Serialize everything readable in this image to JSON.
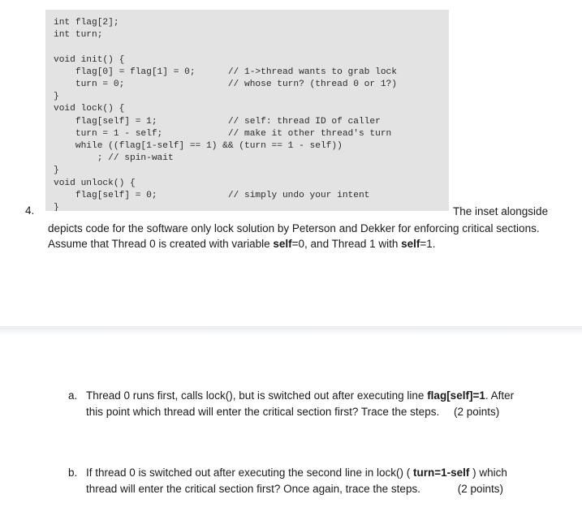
{
  "document": {
    "item_number": "4.",
    "code_inset": {
      "language": "c",
      "lines": "int flag[2];\nint turn;\n\nvoid init() {\n    flag[0] = flag[1] = 0;      // 1->thread wants to grab lock\n    turn = 0;                   // whose turn? (thread 0 or 1?)\n}\nvoid lock() {\n    flag[self] = 1;             // self: thread ID of caller\n    turn = 1 - self;            // make it other thread's turn\n    while ((flag[1-self] == 1) && (turn == 1 - self))\n        ; // spin-wait\n}\nvoid unlock() {\n    flag[self] = 0;             // simply undo your intent\n}"
    },
    "intro": {
      "line1_right": "The inset  alongside",
      "line2_a": "depicts code for the software only lock solution by Peterson and Dekker for enforcing critical",
      "line3_a": "sections. Assume that Thread 0 is created with variable ",
      "line3_b": "self",
      "line3_c": "=0, and Thread 1 with ",
      "line3_d": "self",
      "line3_e": "=1."
    },
    "questions": [
      {
        "marker": "a.",
        "part1": "Thread 0 runs first, calls lock(), but is switched out  after executing line ",
        "bold1": "flag[self]=1",
        "part2": ". After",
        "part3": "this point which thread will enter the critical section first? Trace the steps.",
        "points": "(2 points)"
      },
      {
        "marker": "b.",
        "part1": "If thread 0 is switched out after executing the second line in lock() ( ",
        "bold1": "turn=1-self",
        "part2": " ) which",
        "part3": "thread will enter the critical section first? Once again, trace the steps.",
        "points": "(2 points)"
      }
    ],
    "colors": {
      "page_background": "#ffffff",
      "code_background": "#e3e3e3",
      "text": "#1a1a1a",
      "separator": "#e9eaec"
    }
  }
}
